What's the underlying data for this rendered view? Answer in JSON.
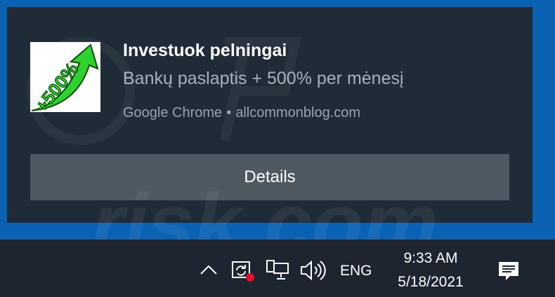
{
  "notification": {
    "title": "Investuok pelningai",
    "message": "Bankų paslaptis + 500% per mėnesį",
    "source_app": "Google Chrome",
    "separator": "•",
    "source_site": "allcommonblog.com",
    "action_label": "Details",
    "icon": {
      "name": "growth-arrow-icon",
      "text": "+500%",
      "colors": {
        "arrow": "#2fd12f",
        "outline": "#0a4d0a",
        "background": "#ffffff"
      }
    }
  },
  "taskbar": {
    "show_hidden_icons": "chevron-up-icon",
    "tray_icons": [
      "sync-alert-icon",
      "network-icon",
      "volume-icon"
    ],
    "language": "ENG",
    "time": "9:33 AM",
    "date": "5/18/2021",
    "action_center_icon": "action-center-icon"
  },
  "colors": {
    "desktop": "#0b62b3",
    "toast_background": "#1f2b36",
    "button": "#4e5962",
    "taskbar": "#1c2530",
    "alert_dot": "#e0102b"
  }
}
